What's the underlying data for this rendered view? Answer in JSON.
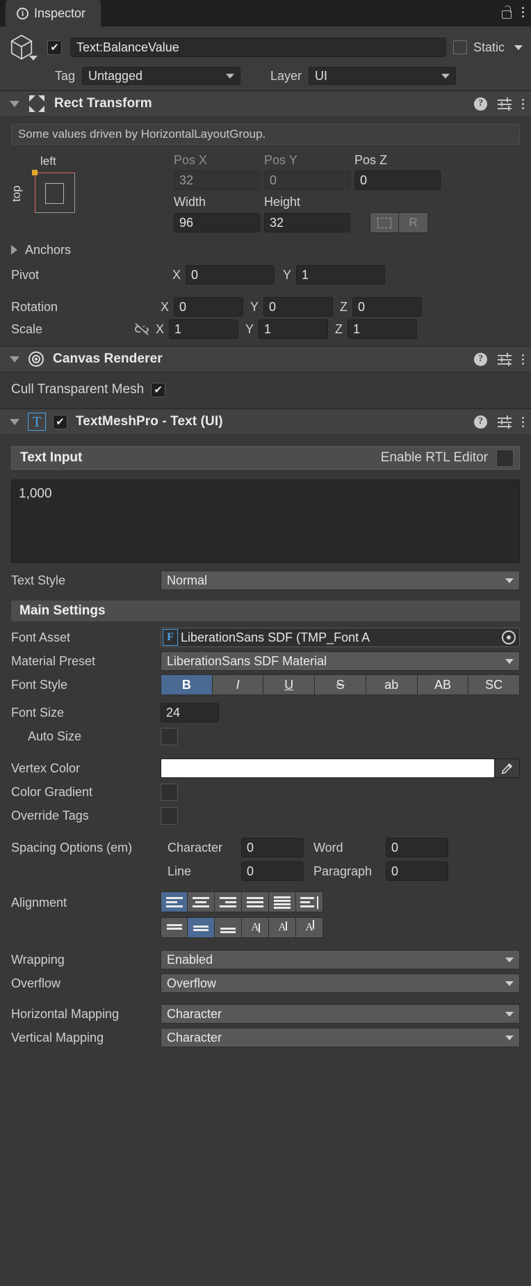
{
  "window": {
    "tab_title": "Inspector",
    "tab_icon": "info-icon",
    "lock_icon": "lock-icon",
    "menu_icon": "kebab-menu-icon"
  },
  "object_header": {
    "enabled": true,
    "name_value": "Text:BalanceValue",
    "static_checked": false,
    "static_label": "Static",
    "tag_label": "Tag",
    "tag_value": "Untagged",
    "layer_label": "Layer",
    "layer_value": "UI"
  },
  "rect_transform": {
    "title": "Rect Transform",
    "driven_notice": "Some values driven by HorizontalLayoutGroup.",
    "anchor_left_label": "left",
    "anchor_top_label": "top",
    "pos_x_label": "Pos X",
    "pos_x_value": "32",
    "pos_y_label": "Pos Y",
    "pos_y_value": "0",
    "pos_z_label": "Pos Z",
    "pos_z_value": "0",
    "width_label": "Width",
    "width_value": "96",
    "height_label": "Height",
    "height_value": "32",
    "blueprint_label": "",
    "raw_label": "R",
    "anchors_label": "Anchors",
    "pivot_label": "Pivot",
    "pivot_x": "0",
    "pivot_y": "1",
    "rotation_label": "Rotation",
    "rotation_x": "0",
    "rotation_y": "0",
    "rotation_z": "0",
    "scale_label": "Scale",
    "scale_x": "1",
    "scale_y": "1",
    "scale_z": "1",
    "axis_x": "X",
    "axis_y": "Y",
    "axis_z": "Z"
  },
  "canvas_renderer": {
    "title": "Canvas Renderer",
    "cull_label": "Cull Transparent Mesh",
    "cull_checked": true
  },
  "textmeshpro": {
    "title": "TextMeshPro - Text (UI)",
    "enabled": true,
    "icon": "tmp-text-icon",
    "text_input_header": "Text Input",
    "rtl_label": "Enable RTL Editor",
    "rtl_checked": false,
    "text_value": "1,000",
    "text_style_label": "Text Style",
    "text_style_value": "Normal",
    "main_settings_header": "Main Settings",
    "font_asset_label": "Font Asset",
    "font_asset_value": "LiberationSans SDF (TMP_Font A",
    "font_asset_badge": "F",
    "material_preset_label": "Material Preset",
    "material_preset_value": "LiberationSans SDF Material",
    "font_style_label": "Font Style",
    "font_style_buttons": [
      {
        "label": "B",
        "active": true
      },
      {
        "label": "I",
        "active": false
      },
      {
        "label": "U",
        "active": false
      },
      {
        "label": "S",
        "active": false
      },
      {
        "label": "ab",
        "active": false
      },
      {
        "label": "AB",
        "active": false
      },
      {
        "label": "SC",
        "active": false
      }
    ],
    "font_size_label": "Font Size",
    "font_size_value": "24",
    "auto_size_label": "Auto Size",
    "auto_size_checked": false,
    "vertex_color_label": "Vertex Color",
    "vertex_color_value": "#FFFFFF",
    "eyedropper_icon": "eyedropper-icon",
    "color_gradient_label": "Color Gradient",
    "color_gradient_checked": false,
    "override_tags_label": "Override Tags",
    "override_tags_checked": false,
    "spacing_label": "Spacing Options (em)",
    "spacing_character_label": "Character",
    "spacing_character_value": "0",
    "spacing_word_label": "Word",
    "spacing_word_value": "0",
    "spacing_line_label": "Line",
    "spacing_line_value": "0",
    "spacing_paragraph_label": "Paragraph",
    "spacing_paragraph_value": "0",
    "alignment_label": "Alignment",
    "alignment_h": [
      {
        "name": "align-left",
        "active": true
      },
      {
        "name": "align-center",
        "active": false
      },
      {
        "name": "align-right",
        "active": false
      },
      {
        "name": "align-justified",
        "active": false
      },
      {
        "name": "align-flush",
        "active": false
      },
      {
        "name": "align-geometry-center",
        "active": false
      }
    ],
    "alignment_v": [
      {
        "name": "align-top",
        "active": false
      },
      {
        "name": "align-middle",
        "active": true
      },
      {
        "name": "align-bottom",
        "active": false
      },
      {
        "name": "align-baseline",
        "active": false
      },
      {
        "name": "align-midline",
        "active": false
      },
      {
        "name": "align-capline",
        "active": false
      }
    ],
    "wrapping_label": "Wrapping",
    "wrapping_value": "Enabled",
    "overflow_label": "Overflow",
    "overflow_value": "Overflow",
    "horizontal_mapping_label": "Horizontal Mapping",
    "horizontal_mapping_value": "Character",
    "vertical_mapping_label": "Vertical Mapping",
    "vertical_mapping_value": "Character"
  },
  "colors": {
    "accent_blue": "#4A6A93",
    "tmp_blue": "#4AA3E8",
    "anchor_red": "#E06A5A",
    "anchor_handle": "#E0A92A",
    "panel_bg": "#383838"
  }
}
